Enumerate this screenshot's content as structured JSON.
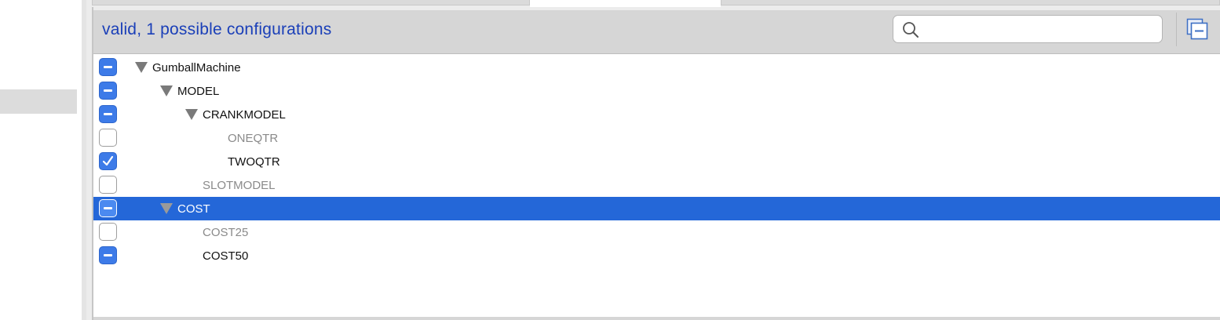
{
  "header": {
    "status_text": "valid, 1 possible configurations",
    "search": {
      "value": "",
      "placeholder": ""
    }
  },
  "colors": {
    "status_text": "#1a3fb8",
    "selection": "#2467d8",
    "checkbox_blue": "#3d7be8"
  },
  "tree": {
    "rows": [
      {
        "label": "GumballMachine",
        "state": "mixed",
        "expanded": true,
        "level": 0,
        "dim": false
      },
      {
        "label": "MODEL",
        "state": "mixed",
        "expanded": true,
        "level": 1,
        "dim": false
      },
      {
        "label": "CRANKMODEL",
        "state": "mixed",
        "expanded": true,
        "level": 2,
        "dim": false
      },
      {
        "label": "ONEQTR",
        "state": "empty",
        "level": 3,
        "dim": true
      },
      {
        "label": "TWOQTR",
        "state": "checked",
        "level": 3,
        "dim": false
      },
      {
        "label": "SLOTMODEL",
        "state": "empty",
        "level": 2,
        "dim": true
      },
      {
        "label": "COST",
        "state": "mixed",
        "expanded": true,
        "level": 1,
        "dim": false,
        "selected": true
      },
      {
        "label": "COST25",
        "state": "empty",
        "level": 2,
        "dim": true
      },
      {
        "label": "COST50",
        "state": "mixed",
        "level": 2,
        "dim": false
      }
    ]
  },
  "icons": {
    "search": "search-icon",
    "collapse_all": "collapse-all-icon",
    "expand_triangle": "triangle-down-icon",
    "check": "checkmark-icon"
  }
}
